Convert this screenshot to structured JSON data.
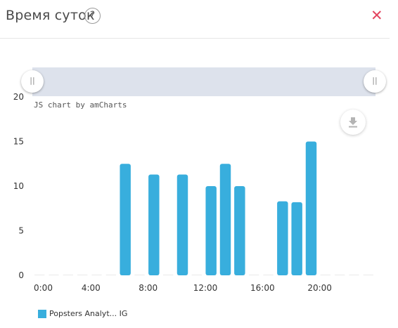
{
  "header": {
    "title": "Время суток",
    "help_label": "?",
    "close_label": "✕"
  },
  "scrollbar": {
    "left_grip_label": "||",
    "right_grip_label": "||"
  },
  "credit": "JS chart by amCharts",
  "export_icon": "download-icon",
  "colors": {
    "bar": "#38aedd",
    "scrollbar": "#dde2ec",
    "close": "#e3455f",
    "grid": "#e9e9e9"
  },
  "legend": {
    "label": "Popsters Analyt... IG"
  },
  "chart_data": {
    "type": "bar",
    "x": [
      0,
      1,
      2,
      3,
      4,
      5,
      6,
      7,
      8,
      9,
      10,
      11,
      12,
      13,
      14,
      15,
      16,
      17,
      18,
      19,
      20,
      21,
      22,
      23
    ],
    "x_tick_labels": [
      "0:00",
      "4:00",
      "8:00",
      "12:00",
      "16:00",
      "20:00"
    ],
    "x_tick_hours": [
      0,
      4,
      8,
      12,
      16,
      20
    ],
    "y_tick_labels": [
      "0",
      "5",
      "10",
      "15",
      "20"
    ],
    "series": [
      {
        "name": "Popsters Analyt... IG",
        "values": [
          0,
          0,
          0,
          0,
          0,
          0,
          12.5,
          0,
          11.3,
          0,
          11.3,
          0,
          10,
          12.5,
          10,
          0,
          0,
          8.3,
          8.2,
          15,
          0,
          0,
          0,
          0
        ]
      }
    ],
    "ylim": [
      0,
      20
    ],
    "xlabel": "",
    "ylabel": "",
    "title": "",
    "grid": false,
    "legend_position": "bottom-left"
  }
}
